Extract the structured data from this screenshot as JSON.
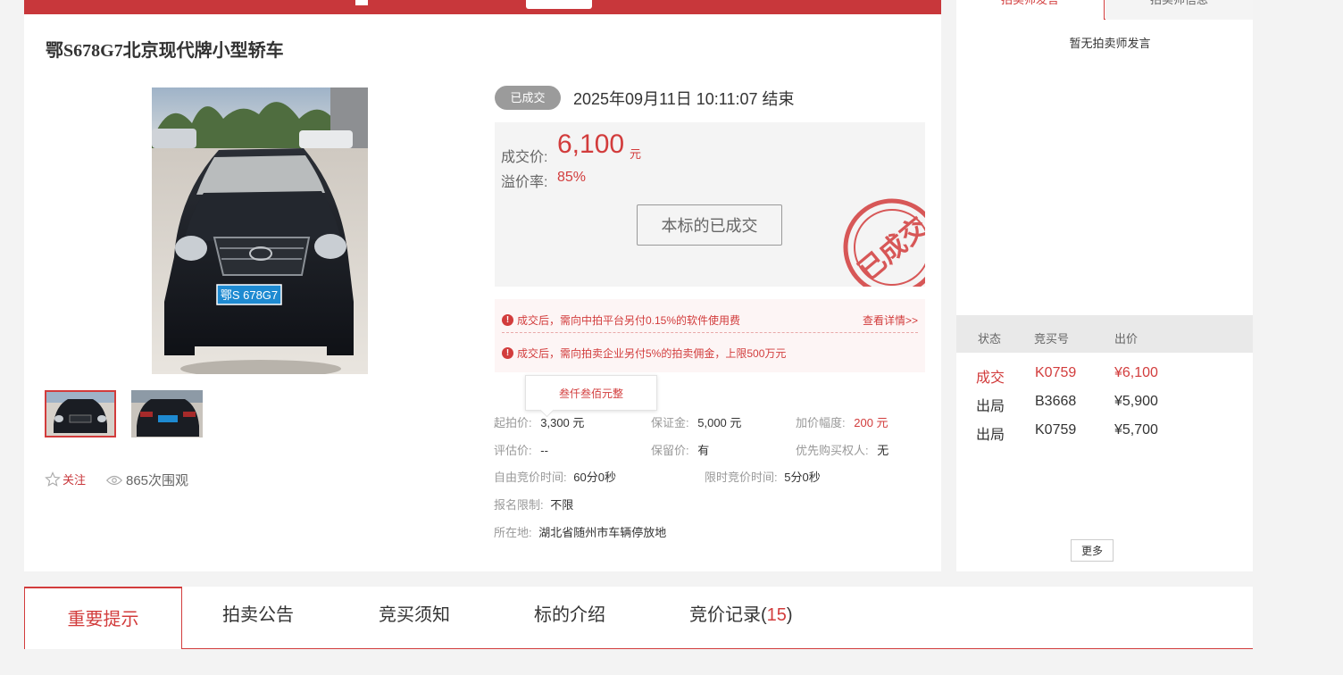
{
  "top_banner": {
    "text": "●●●●●●●●●●●●●",
    "button_label": ""
  },
  "lot": {
    "title": "鄂S678G7北京现代牌小型轿车",
    "plate_text": "鄂S 678G7",
    "status": "已成交",
    "end_time": "2025年09月11日  10:11:07 结束",
    "deal_label": "成交价:",
    "deal_price": "6,100",
    "deal_unit": "元",
    "premium_label": "溢价率:",
    "premium_value": "85%",
    "sold_button": "本标的已成交",
    "stamp_text": "已成交",
    "follow_label": "关注",
    "views": "865次围观"
  },
  "notices": {
    "n1": "成交后，需向中拍平台另付0.15%的软件使用费",
    "n1_link": "查看详情>>",
    "n2": "成交后，需向拍卖企业另付5%的拍卖佣金，上限500万元"
  },
  "tooltip": "叁仟叁佰元整",
  "info": {
    "start_price_label": "起拍价:",
    "start_price": "3,300 元",
    "deposit_label": "保证金:",
    "deposit": "5,000 元",
    "increment_label": "加价幅度:",
    "increment": "200 元",
    "eval_label": "评估价:",
    "eval": "--",
    "reserve_label": "保留价:",
    "reserve": "有",
    "priority_label": "优先购买权人:",
    "priority": "无",
    "free_time_label": "自由竞价时间:",
    "free_time": "60分0秒",
    "limit_time_label": "限时竞价时间:",
    "limit_time": "5分0秒",
    "signup_label": "报名限制:",
    "signup": "不限",
    "location_label": "所在地:",
    "location": "湖北省随州市车辆停放地"
  },
  "right_panel": {
    "tab_1": "拍卖师发言",
    "tab_2": "拍卖师信息",
    "no_speech": "暂无拍卖师发言",
    "bid_headers": [
      "状态",
      "竞买号",
      "出价"
    ],
    "bids": [
      {
        "status": "成交",
        "bidder": "K0759",
        "price": "¥6,100"
      },
      {
        "status": "出局",
        "bidder": "B3668",
        "price": "¥5,900"
      },
      {
        "status": "出局",
        "bidder": "K0759",
        "price": "¥5,700"
      }
    ],
    "more_button": "更多"
  },
  "bottom_tabs": {
    "t1": "重要提示",
    "t2": "拍卖公告",
    "t3": "竞买须知",
    "t4": "标的介绍",
    "t5": "竞价记录(",
    "t5_count": "15",
    "t5_close": ")"
  },
  "colors": {
    "accent": "#c8373b",
    "status_grey": "#9b9b9b"
  }
}
